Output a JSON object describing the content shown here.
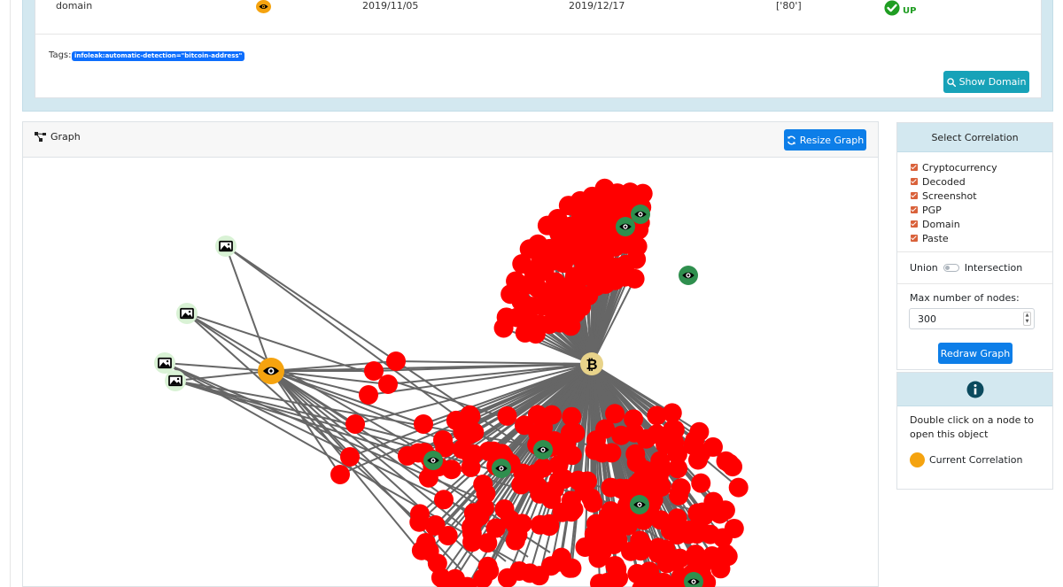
{
  "domain_row": {
    "type": "domain",
    "first_seen": "2019/11/05",
    "last_check": "2019/12/17",
    "ports": "['80']",
    "status": "UP"
  },
  "tags": {
    "label": "Tags:",
    "items": [
      "infoleak:automatic-detection=\"bitcoin-address\""
    ]
  },
  "show_domain_label": "Show Domain",
  "graph": {
    "title": "Graph",
    "resize_label": "Resize Graph"
  },
  "sidebar": {
    "header": "Select Correlation",
    "correlations": [
      "Cryptocurrency",
      "Decoded",
      "Screenshot",
      "PGP",
      "Domain",
      "Paste"
    ],
    "union_label": "Union",
    "intersection_label": "Intersection",
    "max_nodes_label": "Max number of nodes:",
    "max_nodes_value": "300",
    "redraw_label": "Redraw Graph"
  },
  "info": {
    "text": "Double click on a node to open this object",
    "legend_label": "Current Correlation"
  },
  "colors": {
    "current": "#f5a30f",
    "node": "#ff0000",
    "paste": "#2f8f4e",
    "bitcoin": "#e8d38a",
    "screenshot_bg": "#d9f2d5",
    "primary_button": "#0d7ee8",
    "info_button": "#17a2b8"
  }
}
